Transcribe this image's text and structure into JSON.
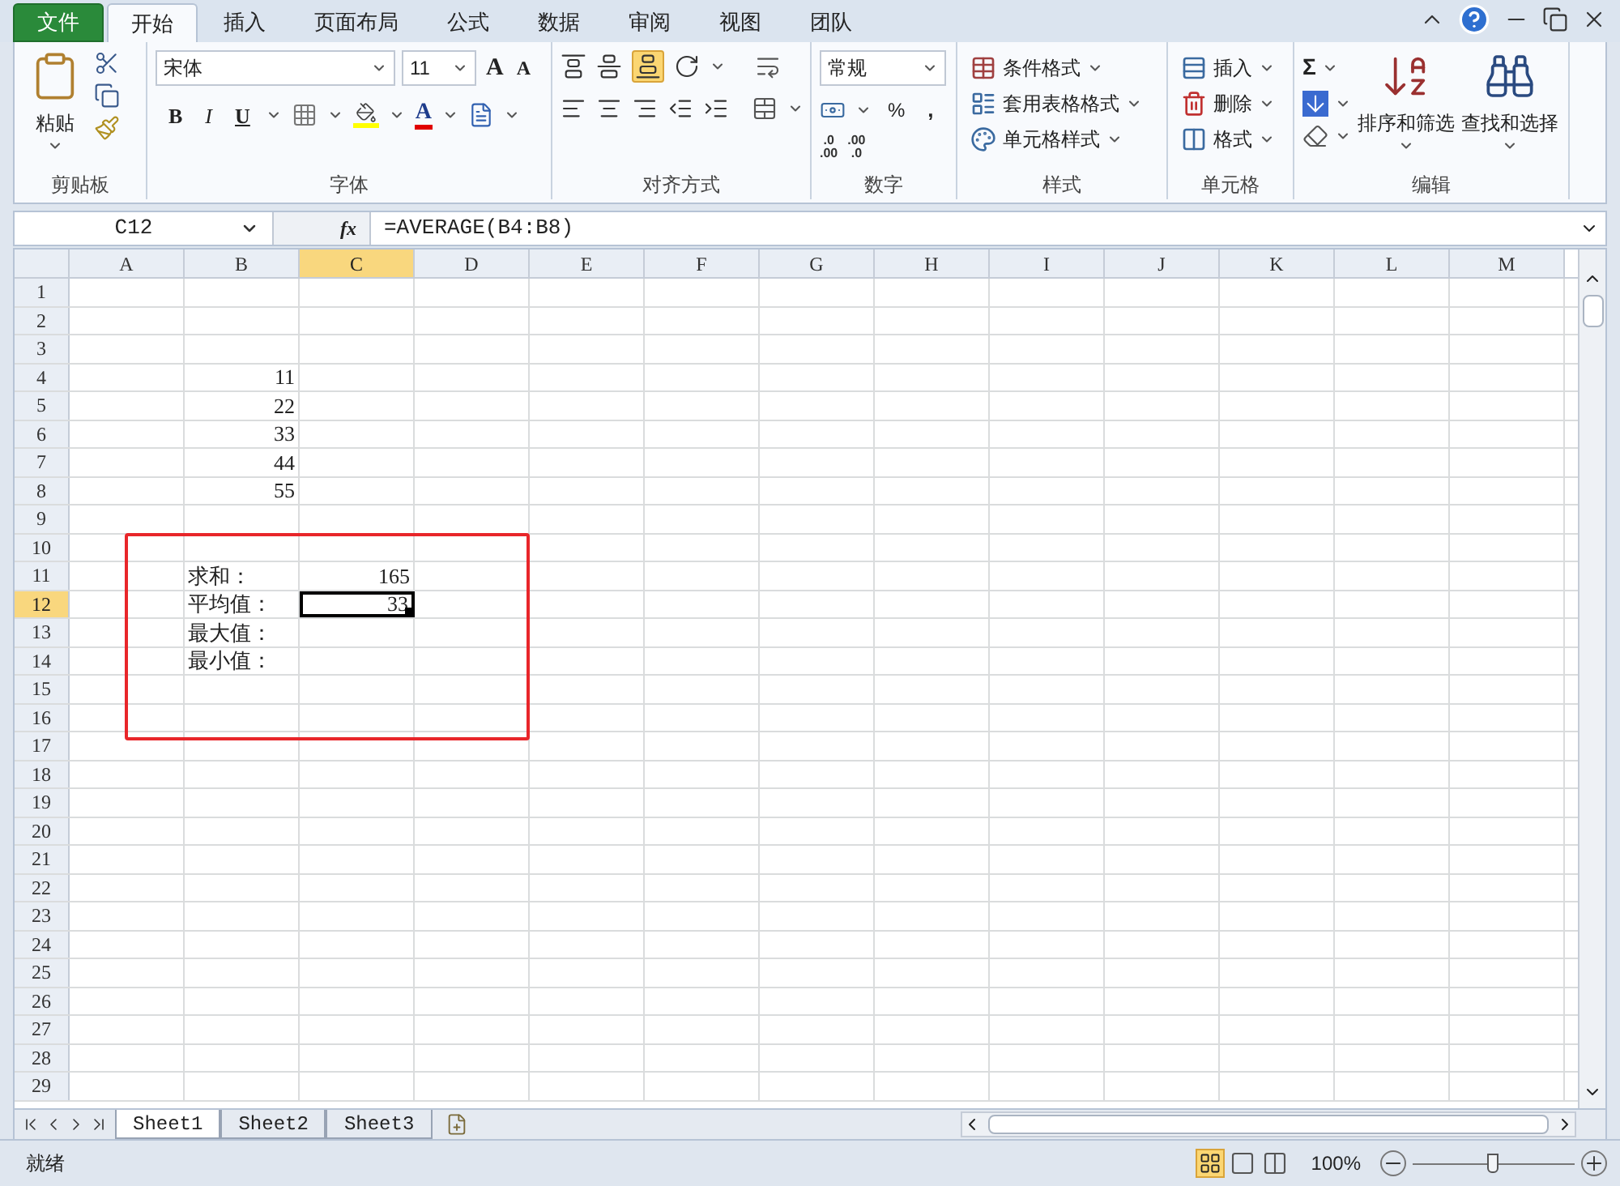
{
  "ribbon_tabs": [
    {
      "label": "文件",
      "kind": "file",
      "selected": false
    },
    {
      "label": "开始",
      "kind": "tab",
      "selected": true
    },
    {
      "label": "插入",
      "kind": "tab",
      "selected": false
    },
    {
      "label": "页面布局",
      "kind": "tab",
      "selected": false
    },
    {
      "label": "公式",
      "kind": "tab",
      "selected": false
    },
    {
      "label": "数据",
      "kind": "tab",
      "selected": false
    },
    {
      "label": "审阅",
      "kind": "tab",
      "selected": false
    },
    {
      "label": "视图",
      "kind": "tab",
      "selected": false
    },
    {
      "label": "团队",
      "kind": "tab",
      "selected": false
    }
  ],
  "clipboard": {
    "paste": "粘贴",
    "group": "剪贴板"
  },
  "font": {
    "name": "宋体",
    "size": "11",
    "grow": "A",
    "shrink": "A",
    "bold": "B",
    "italic": "I",
    "underline": "U",
    "color_letter": "A",
    "group": "字体"
  },
  "alignment": {
    "group": "对齐方式"
  },
  "number": {
    "format": "常规",
    "percent": "%",
    "comma": ",",
    "increase_decimal": {
      "top": ".0",
      "bottom": ".00"
    },
    "decrease_decimal": {
      "top": ".00",
      "bottom": ".0"
    },
    "group": "数字"
  },
  "styles": {
    "items": [
      "条件格式",
      "套用表格格式",
      "单元格样式"
    ],
    "group": "样式"
  },
  "cells": {
    "items": [
      "插入",
      "删除",
      "格式"
    ],
    "group": "单元格"
  },
  "editing": {
    "sum": "Σ",
    "sort": "排序和筛选",
    "find": "查找和选择",
    "group": "编辑"
  },
  "formula_bar": {
    "name_box": "C12",
    "fx": "fx",
    "formula": "=AVERAGE(B4:B8)"
  },
  "columns": [
    {
      "label": "A",
      "selected": false
    },
    {
      "label": "B",
      "selected": false
    },
    {
      "label": "C",
      "selected": true
    },
    {
      "label": "D",
      "selected": false
    },
    {
      "label": "E",
      "selected": false
    },
    {
      "label": "F",
      "selected": false
    },
    {
      "label": "G",
      "selected": false
    },
    {
      "label": "H",
      "selected": false
    },
    {
      "label": "I",
      "selected": false
    },
    {
      "label": "J",
      "selected": false
    },
    {
      "label": "K",
      "selected": false
    },
    {
      "label": "L",
      "selected": false
    },
    {
      "label": "M",
      "selected": false
    }
  ],
  "rows": [
    {
      "label": "1",
      "selected": false,
      "cells": []
    },
    {
      "label": "2",
      "selected": false,
      "cells": []
    },
    {
      "label": "3",
      "selected": false,
      "cells": []
    },
    {
      "label": "4",
      "selected": false,
      "cells": [
        null,
        {
          "text": "11",
          "kind": "number",
          "selected": false
        }
      ]
    },
    {
      "label": "5",
      "selected": false,
      "cells": [
        null,
        {
          "text": "22",
          "kind": "number",
          "selected": false
        }
      ]
    },
    {
      "label": "6",
      "selected": false,
      "cells": [
        null,
        {
          "text": "33",
          "kind": "number",
          "selected": false
        }
      ]
    },
    {
      "label": "7",
      "selected": false,
      "cells": [
        null,
        {
          "text": "44",
          "kind": "number",
          "selected": false
        }
      ]
    },
    {
      "label": "8",
      "selected": false,
      "cells": [
        null,
        {
          "text": "55",
          "kind": "number",
          "selected": false
        }
      ]
    },
    {
      "label": "9",
      "selected": false,
      "cells": []
    },
    {
      "label": "10",
      "selected": false,
      "cells": []
    },
    {
      "label": "11",
      "selected": false,
      "cells": [
        null,
        {
          "text": "求和：",
          "kind": "text",
          "selected": false
        },
        {
          "text": "165",
          "kind": "number",
          "selected": false
        }
      ]
    },
    {
      "label": "12",
      "selected": true,
      "cells": [
        null,
        {
          "text": "平均值：",
          "kind": "text",
          "selected": false
        },
        {
          "text": "33",
          "kind": "number",
          "selected": true
        }
      ]
    },
    {
      "label": "13",
      "selected": false,
      "cells": [
        null,
        {
          "text": "最大值：",
          "kind": "text",
          "selected": false
        }
      ]
    },
    {
      "label": "14",
      "selected": false,
      "cells": [
        null,
        {
          "text": "最小值：",
          "kind": "text",
          "selected": false
        }
      ]
    },
    {
      "label": "15",
      "selected": false,
      "cells": []
    },
    {
      "label": "16",
      "selected": false,
      "cells": []
    },
    {
      "label": "17",
      "selected": false,
      "cells": []
    },
    {
      "label": "18",
      "selected": false,
      "cells": []
    },
    {
      "label": "19",
      "selected": false,
      "cells": []
    },
    {
      "label": "20",
      "selected": false,
      "cells": []
    },
    {
      "label": "21",
      "selected": false,
      "cells": []
    },
    {
      "label": "22",
      "selected": false,
      "cells": []
    },
    {
      "label": "23",
      "selected": false,
      "cells": []
    },
    {
      "label": "24",
      "selected": false,
      "cells": []
    },
    {
      "label": "25",
      "selected": false,
      "cells": []
    },
    {
      "label": "26",
      "selected": false,
      "cells": []
    },
    {
      "label": "27",
      "selected": false,
      "cells": []
    },
    {
      "label": "28",
      "selected": false,
      "cells": []
    },
    {
      "label": "29",
      "selected": false,
      "cells": []
    }
  ],
  "sheet_tabs": [
    {
      "label": "Sheet1",
      "selected": true
    },
    {
      "label": "Sheet2",
      "selected": false
    },
    {
      "label": "Sheet3",
      "selected": false
    }
  ],
  "status_bar": {
    "text": "就绪",
    "views": [
      {
        "kind": "normal",
        "selected": true
      },
      {
        "kind": "page_layout",
        "selected": false
      },
      {
        "kind": "page_break",
        "selected": false
      }
    ],
    "zoom": "100%",
    "zoom_slider": {
      "level": 0.5
    }
  }
}
